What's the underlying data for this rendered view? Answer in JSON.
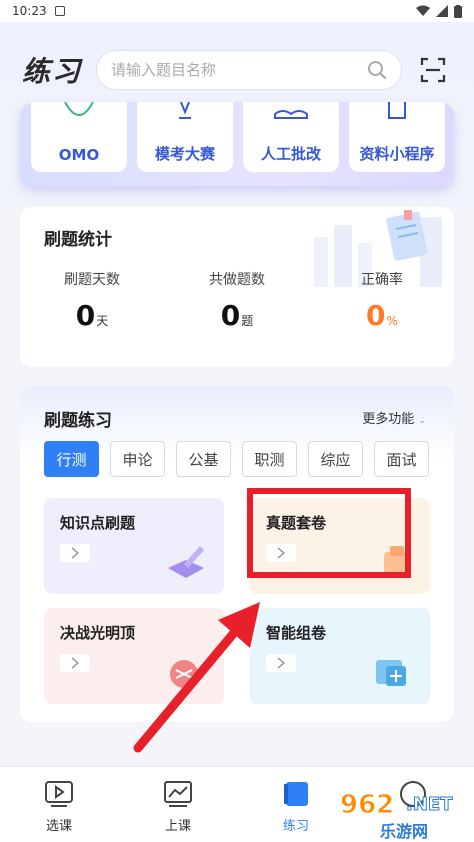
{
  "status_bar": {
    "time": "10:23"
  },
  "header": {
    "title": "练习",
    "search_placeholder": "请输入题目名称"
  },
  "tools": [
    {
      "label": "OMO"
    },
    {
      "label": "模考大赛"
    },
    {
      "label": "人工批改"
    },
    {
      "label": "资料小程序"
    }
  ],
  "stats": {
    "title": "刷题统计",
    "items": [
      {
        "label": "刷题天数",
        "value": "0",
        "unit": "天"
      },
      {
        "label": "共做题数",
        "value": "0",
        "unit": "题"
      },
      {
        "label": "正确率",
        "value": "0",
        "unit": "%"
      }
    ]
  },
  "practice": {
    "title": "刷题练习",
    "more": "更多功能",
    "tabs": [
      "行测",
      "申论",
      "公基",
      "职测",
      "综应",
      "面试"
    ],
    "active_tab": "行测",
    "tiles": [
      {
        "label": "知识点刷题"
      },
      {
        "label": "真题套卷"
      },
      {
        "label": "决战光明顶"
      },
      {
        "label": "智能组卷"
      }
    ]
  },
  "bottom_nav": [
    {
      "label": "选课"
    },
    {
      "label": "上课"
    },
    {
      "label": "练习"
    }
  ],
  "watermark": {
    "text_top": "962",
    "text_top_suffix": ".NET",
    "text_bottom": "乐游网"
  },
  "colors": {
    "accent": "#2f7ff5",
    "highlight": "#e8202a",
    "orange": "#ff7a2b"
  }
}
